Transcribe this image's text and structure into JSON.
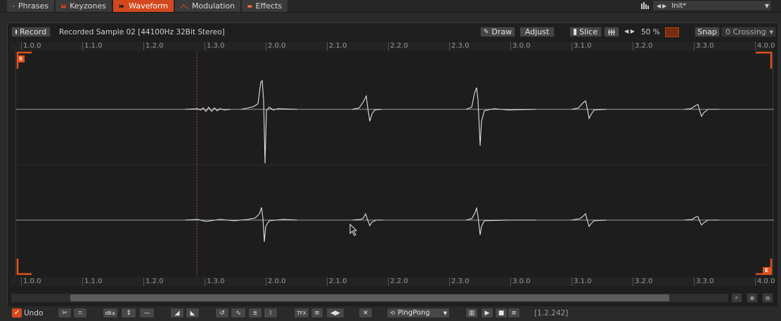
{
  "tabs": [
    {
      "label": "Phrases",
      "icon": "phrases-icon",
      "active": false
    },
    {
      "label": "Keyzones",
      "icon": "keyzones-icon",
      "active": false
    },
    {
      "label": "Waveform",
      "icon": "waveform-icon",
      "active": true
    },
    {
      "label": "Modulation",
      "icon": "modulation-icon",
      "active": false
    },
    {
      "label": "Effects",
      "icon": "effects-icon",
      "active": false
    }
  ],
  "preset": {
    "name": "Init*"
  },
  "toolbar": {
    "record_label": "Record",
    "sample_info": "Recorded Sample 02 [44100Hz 32Bit Stereo]",
    "draw_label": "Draw",
    "adjust_label": "Adjust",
    "slice_label": "Slice",
    "zoom_value": "50 %",
    "snap_label": "Snap",
    "snap_mode": "0 Crossing"
  },
  "ruler_labels": [
    "1.0.0",
    "1.1.0",
    "1.2.0",
    "1.3.0",
    "2.0.0",
    "2.1.0",
    "2.2.0",
    "2.3.0",
    "3.0.0",
    "3.1.0",
    "3.2.0",
    "3.3.0",
    "4.0.0"
  ],
  "markers": {
    "start": "S",
    "end": "E"
  },
  "bottom": {
    "undo_label": "Undo",
    "loop_mode": "PingPong",
    "tfx_label": "TFX",
    "position": "[1.2.242]"
  },
  "colors": {
    "accent": "#d3481c",
    "waveform": "#d8d8d8",
    "background": "#1d1d1d"
  }
}
